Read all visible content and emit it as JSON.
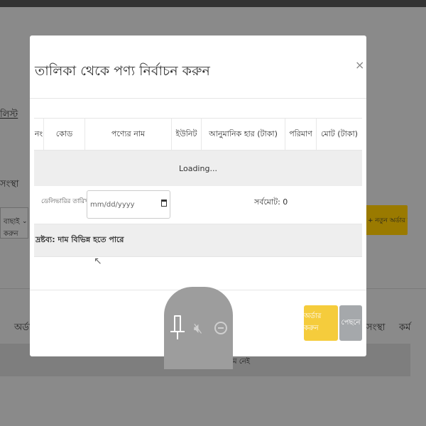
{
  "background": {
    "left_link": "লিস্ট",
    "left_label": "সংস্থা",
    "left_select_value": "বাছাই করুন",
    "new_order_button": "+ নতুন অর্ডার করুন",
    "table_header_left": "অর্ডার",
    "table_header_right_1": "সংস্থা",
    "table_header_right_2": "কর্ম",
    "empty_row_text": "তালিকায় কোনো আইটেম নেই"
  },
  "modal": {
    "title": "তালিকা থেকে পণ্য নির্বাচন করুন",
    "close_label": "×",
    "columns": [
      "নং",
      "কোড",
      "পণ্যের নাম",
      "ইউনিট",
      "আনুমানিক হার (টাকা)",
      "পরিমাণ",
      "মোট (টাকা)"
    ],
    "loading_text": "Loading...",
    "delivery_label": "ডেলিভারির তারিখ",
    "delivery_required_mark": "*",
    "date_placeholder": "mm/dd/yyyy",
    "total_label": "সর্বমোট: 0",
    "note": "দ্রষ্টব্য: দাম বিভিন্ন হতে পারে",
    "cursor_glyph": "↖",
    "order_button": "অর্ডার করুন",
    "back_button": "পেছনে"
  },
  "floating_controls": {
    "icons": [
      "pin-icon",
      "mute-icon",
      "minus-circle-icon"
    ]
  }
}
